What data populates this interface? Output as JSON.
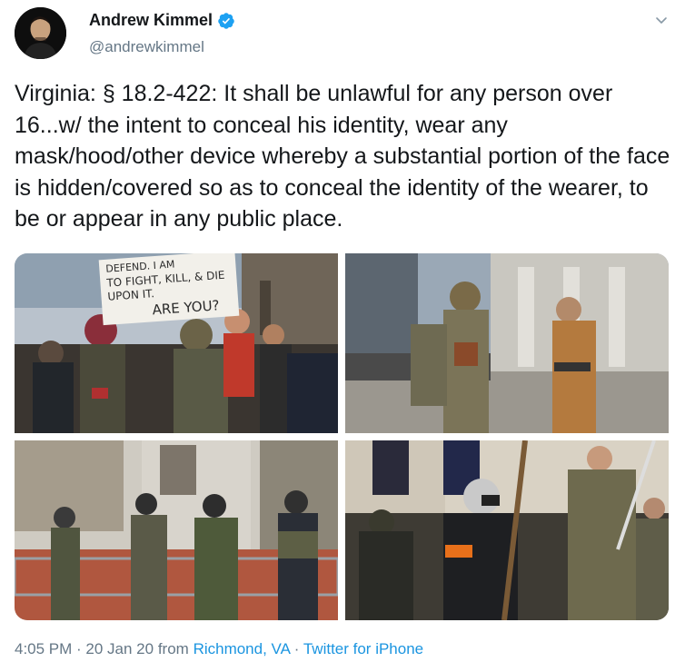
{
  "author": {
    "display_name": "Andrew Kimmel",
    "handle": "@andrewkimmel",
    "verified": true,
    "avatar_icon": "avatar-photo"
  },
  "tweet": {
    "text": "Virginia: § 18.2-422: It shall be unlawful for any person over 16...w/ the intent to conceal his identity, wear any mask/hood/other device whereby a substantial portion of the face is hidden/covered so as to conceal the identity of the wearer, to be or appear in any public place."
  },
  "media": {
    "photo_1_sign": [
      "DEFEND. I AM",
      "TO FIGHT, KILL, & DIE",
      "UPON IT.",
      "ARE YOU?"
    ]
  },
  "meta": {
    "time": "4:05 PM",
    "separator_1": " · ",
    "date": "20 Jan 20",
    "from": " from ",
    "location": "Richmond, VA",
    "separator_2": " · ",
    "client": "Twitter for iPhone"
  },
  "colors": {
    "link": "#1b95e0",
    "secondary_text": "#657786",
    "verified": "#1da1f2"
  }
}
